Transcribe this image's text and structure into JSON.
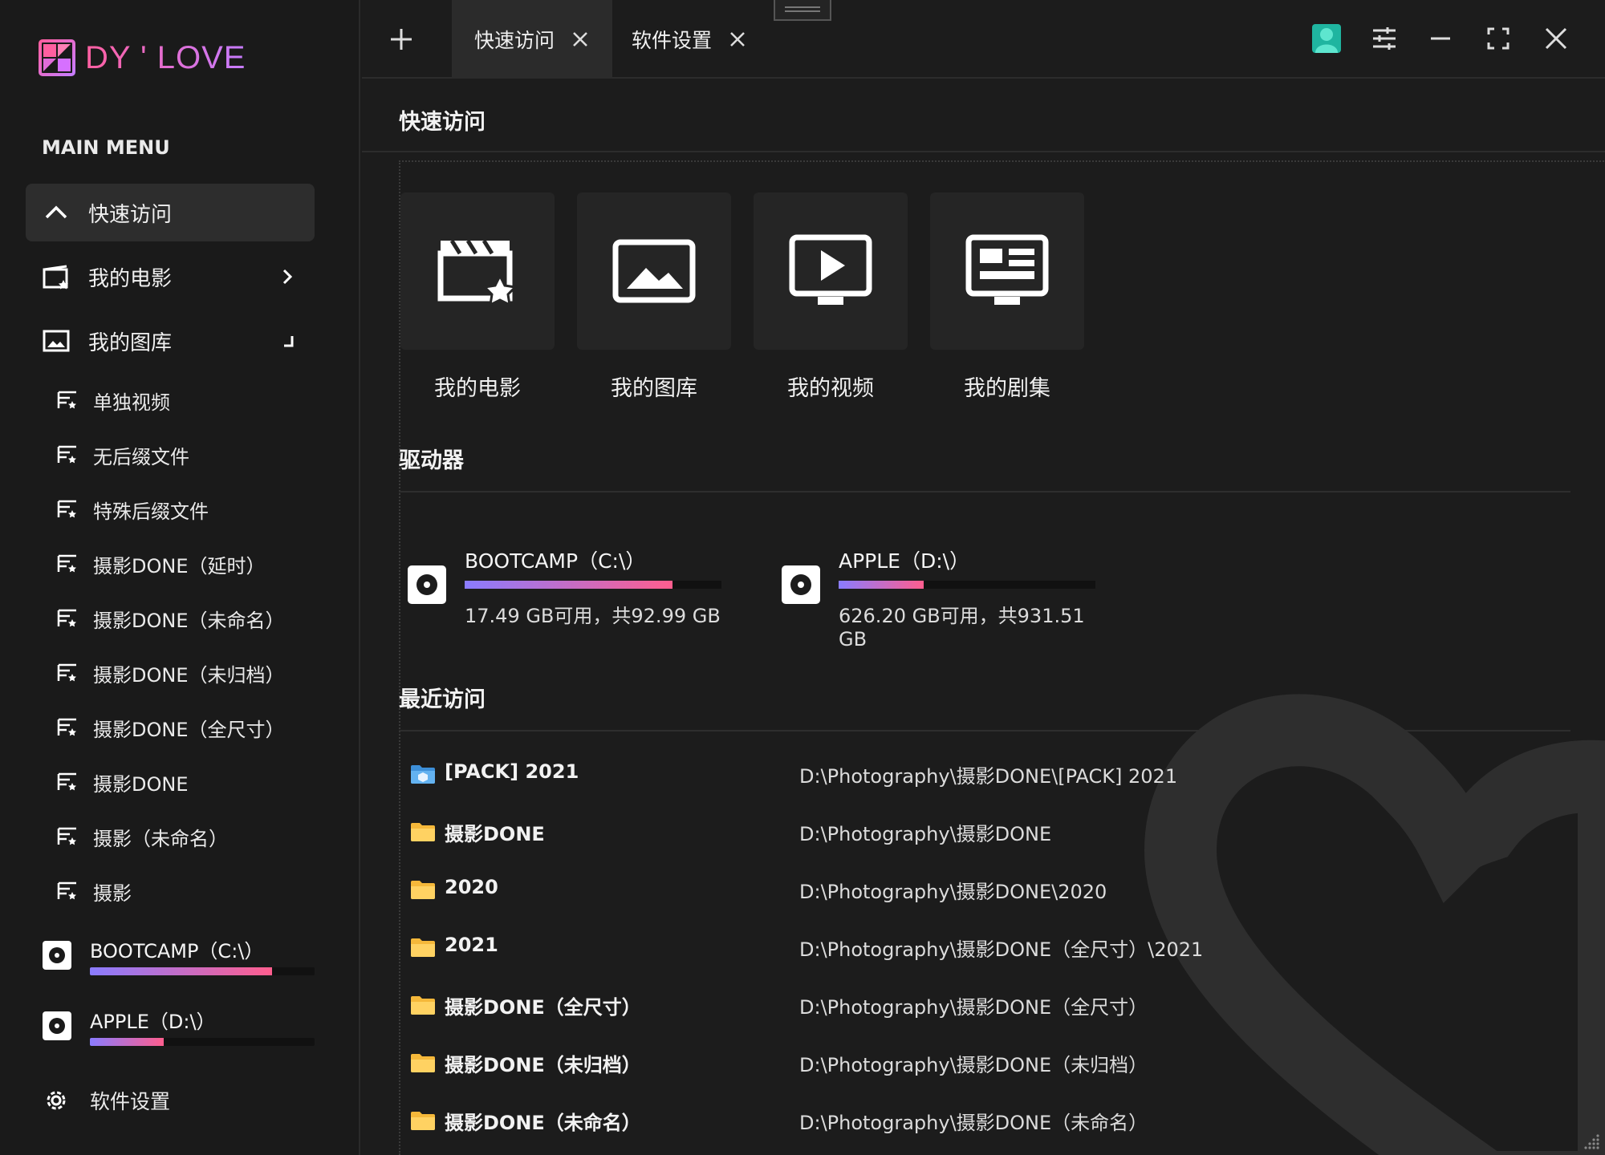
{
  "app": {
    "logo_text": "DY ' LOVE",
    "accent_pink": "#ff5fa0",
    "accent_purple": "#8a7cff"
  },
  "sidebar": {
    "menu_label": "MAIN MENU",
    "items": [
      {
        "label": "快速访问",
        "icon": "chevron-up-icon",
        "active": true
      },
      {
        "label": "我的电影",
        "icon": "movie-icon"
      },
      {
        "label": "我的图库",
        "icon": "image-icon"
      }
    ],
    "sub_items": [
      "单独视频",
      "无后缀文件",
      "特殊后缀文件",
      "摄影DONE（延时）",
      "摄影DONE（未命名）",
      "摄影DONE（未归档）",
      "摄影DONE（全尺寸）",
      "摄影DONE",
      "摄影（未命名）",
      "摄影"
    ],
    "drives": [
      {
        "name": "BOOTCAMP（C:\\）",
        "used_fraction": 0.81
      },
      {
        "name": "APPLE（D:\\）",
        "used_fraction": 0.33
      }
    ],
    "settings_label": "软件设置"
  },
  "tabs": [
    {
      "label": "快速访问",
      "active": true
    },
    {
      "label": "软件设置",
      "active": false
    }
  ],
  "content": {
    "page_title": "快速访问",
    "quick_tiles": [
      {
        "label": "我的电影",
        "icon": "movie-star-icon"
      },
      {
        "label": "我的图库",
        "icon": "image-icon"
      },
      {
        "label": "我的视频",
        "icon": "video-play-icon"
      },
      {
        "label": "我的剧集",
        "icon": "series-icon"
      }
    ],
    "drives_title": "驱动器",
    "drives": [
      {
        "name": "BOOTCAMP（C:\\）",
        "free_text": "17.49 GB可用，共92.99 GB",
        "used_fraction": 0.81
      },
      {
        "name": "APPLE（D:\\）",
        "free_text": "626.20 GB可用，共931.51 GB",
        "used_fraction": 0.33
      }
    ],
    "recent_title": "最近访问",
    "recent": [
      {
        "name": "[PACK] 2021",
        "path": "D:\\Photography\\摄影DONE\\[PACK] 2021",
        "icon": "pack-folder-icon"
      },
      {
        "name": "摄影DONE",
        "path": "D:\\Photography\\摄影DONE",
        "icon": "folder-icon"
      },
      {
        "name": "2020",
        "path": "D:\\Photography\\摄影DONE\\2020",
        "icon": "folder-icon"
      },
      {
        "name": "2021",
        "path": "D:\\Photography\\摄影DONE（全尺寸）\\2021",
        "icon": "folder-icon"
      },
      {
        "name": "摄影DONE（全尺寸）",
        "path": "D:\\Photography\\摄影DONE（全尺寸）",
        "icon": "folder-icon"
      },
      {
        "name": "摄影DONE（未归档）",
        "path": "D:\\Photography\\摄影DONE（未归档）",
        "icon": "folder-icon"
      },
      {
        "name": "摄影DONE（未命名）",
        "path": "D:\\Photography\\摄影DONE（未命名）",
        "icon": "folder-icon"
      }
    ]
  }
}
